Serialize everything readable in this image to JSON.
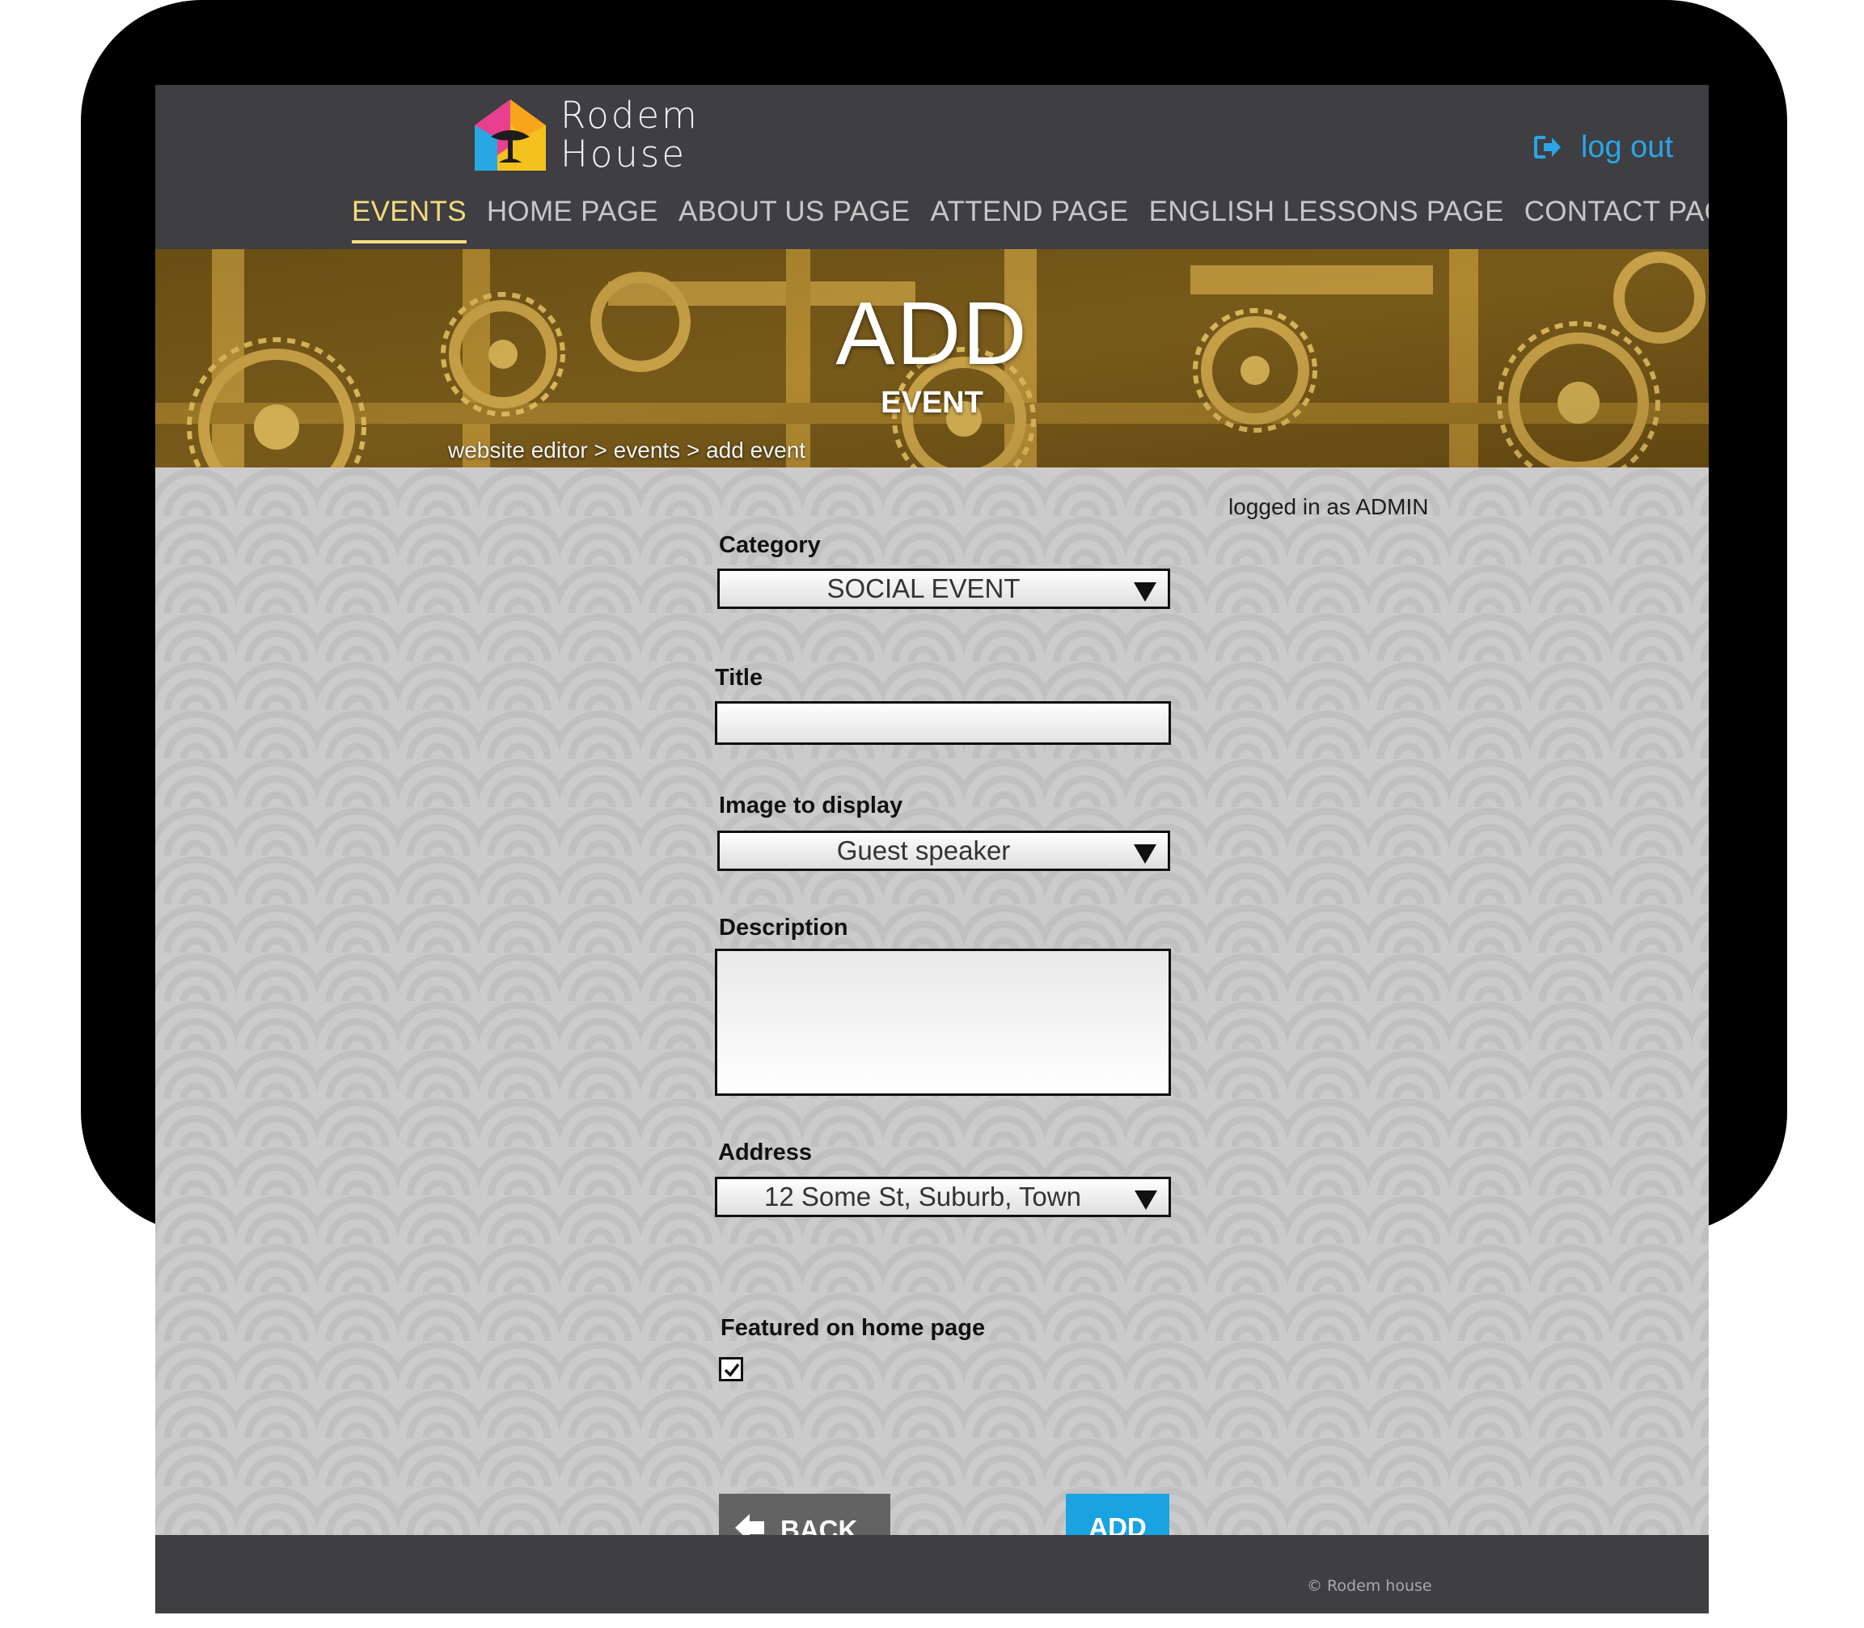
{
  "header": {
    "logo_line1": "Rodem",
    "logo_line2": "House",
    "logout_label": "log out",
    "nav": [
      "EVENTS",
      "HOME PAGE",
      "ABOUT US PAGE",
      "ATTEND PAGE",
      "ENGLISH LESSONS PAGE",
      "CONTACT PAGE"
    ],
    "active_nav": "EVENTS"
  },
  "banner": {
    "title": "ADD",
    "subtitle": "EVENT",
    "breadcrumb": "website editor > events > add event"
  },
  "status": {
    "logged_in": "logged in as ADMIN"
  },
  "form": {
    "category_label": "Category",
    "category_value": "SOCIAL EVENT",
    "title_label": "Title",
    "title_value": "",
    "image_label": "Image to display",
    "image_value": "Guest speaker",
    "description_label": "Description",
    "description_value": "",
    "address_label": "Address",
    "address_value": "12 Some St, Suburb, Town",
    "featured_label": "Featured on home page",
    "featured_checked": true,
    "back_label": "BACK",
    "add_label": "ADD"
  },
  "footer": {
    "copyright": "© Rodem house"
  },
  "colors": {
    "header_bg": "#3f3e42",
    "active_nav": "#f3dc7a",
    "link_blue": "#29a6e6",
    "add_button": "#1aa3e1",
    "back_button": "#636363"
  },
  "icons": [
    "logo-house-icon",
    "logout-icon",
    "chevron-down-icon",
    "back-arrow-icon",
    "checkmark-icon"
  ]
}
